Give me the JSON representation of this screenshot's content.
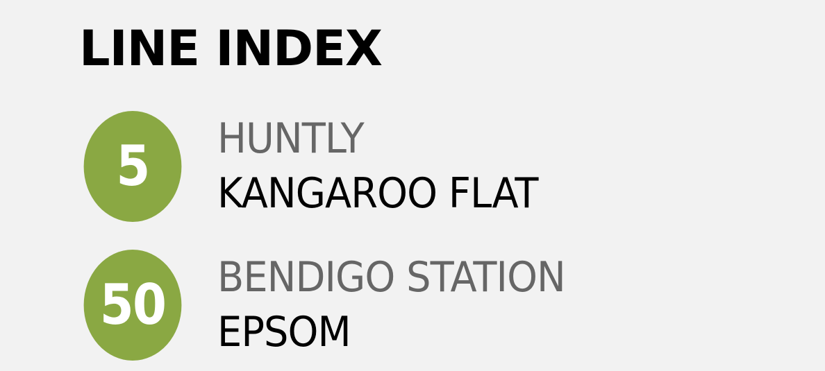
{
  "header": {
    "title": "LINE INDEX"
  },
  "colors": {
    "background": "#f2f2f2",
    "badge": "#8aa843",
    "origin_text": "#666666",
    "destination_text": "#000000"
  },
  "lines": [
    {
      "number": "5",
      "origin": "HUNTLY",
      "destination": "KANGAROO FLAT"
    },
    {
      "number": "50",
      "origin": "BENDIGO STATION",
      "destination": "EPSOM"
    }
  ]
}
